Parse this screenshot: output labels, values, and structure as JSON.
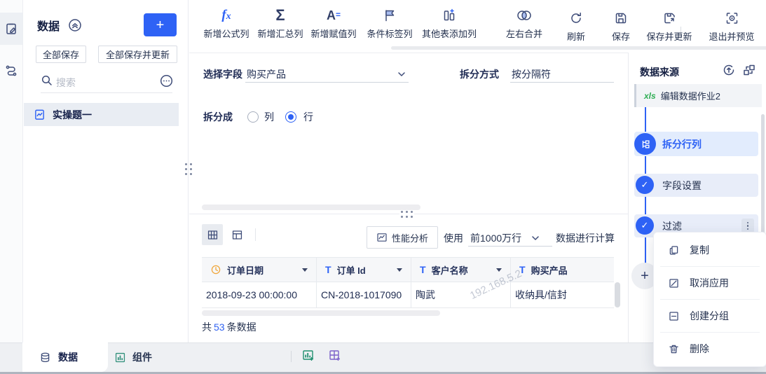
{
  "window": {
    "watermark": "192.168.5.2"
  },
  "colors": {
    "accent_blue": "#2e62f5",
    "text_navy": "#1e2b50",
    "xls_green": "#2fae54",
    "clock_orange": "#f0a63a",
    "chart_green": "#1f8f6e",
    "board_purple": "#7b61c9",
    "step_active_bg": "#e2ecfd",
    "step_bg": "#e8edf9",
    "selected_item_bg": "#e9edf3"
  },
  "left_rail": {
    "icons": [
      {
        "name": "edit-board-icon"
      },
      {
        "name": "flow-icon"
      }
    ]
  },
  "sidebar": {
    "title": "数据",
    "add_button": "+",
    "save_all": "全部保存",
    "save_all_update": "全部保存并更新",
    "search": {
      "placeholder": "搜索"
    },
    "items": [
      {
        "label": "实操题一"
      }
    ]
  },
  "toolbar": {
    "items": [
      {
        "label": "新增公式列",
        "icon": "formula-icon"
      },
      {
        "label": "新增汇总列",
        "icon": "sigma-icon"
      },
      {
        "label": "新增赋值列",
        "icon": "assign-value-icon"
      },
      {
        "label": "条件标签列",
        "icon": "flag-icon"
      },
      {
        "label": "其他表添加列",
        "icon": "add-column-icon"
      },
      {
        "label": "左右合并",
        "icon": "merge-icon"
      },
      {
        "label": "刷新",
        "icon": "refresh-icon"
      },
      {
        "label": "保存",
        "icon": "save-icon"
      },
      {
        "label": "保存并更新",
        "icon": "save-update-icon"
      },
      {
        "label": "退出并预览",
        "icon": "preview-icon"
      }
    ]
  },
  "form": {
    "select_field": {
      "label": "选择字段",
      "value": "购买产品"
    },
    "split_method": {
      "label": "拆分方式",
      "value": "按分隔符"
    },
    "split_into": {
      "label": "拆分成",
      "options": [
        {
          "label": "列",
          "selected": false
        },
        {
          "label": "行",
          "selected": true
        }
      ]
    }
  },
  "preview": {
    "performance_button": "性能分析",
    "use_label": "使用",
    "row_limit": "前1000万行",
    "calc_label": "数据进行计算",
    "total": {
      "prefix": "共",
      "count": "53",
      "suffix": "条数据"
    }
  },
  "table": {
    "columns": [
      {
        "label": "订单日期",
        "type": "date"
      },
      {
        "label": "订单 Id",
        "type": "text"
      },
      {
        "label": "客户名称",
        "type": "text"
      },
      {
        "label": "购买产品",
        "type": "text"
      }
    ],
    "rows": [
      {
        "order_date": "2018-09-23 00:00:00",
        "order_id": "CN-2018-1017090",
        "customer": "陶武",
        "product": "收纳具/信封"
      }
    ]
  },
  "right_panel": {
    "title": "数据来源",
    "add_button": "+",
    "source": {
      "badge": "xls",
      "label": "编辑数据作业2"
    },
    "steps": [
      {
        "label": "拆分行列",
        "state": "active"
      },
      {
        "label": "字段设置",
        "state": "done"
      },
      {
        "label": "过滤",
        "state": "done"
      }
    ]
  },
  "context_menu": {
    "items": [
      {
        "label": "复制",
        "icon": "copy-icon"
      },
      {
        "label": "取消应用",
        "icon": "cancel-apply-icon"
      },
      {
        "label": "创建分组",
        "icon": "create-group-icon"
      },
      {
        "label": "删除",
        "icon": "delete-icon"
      }
    ]
  },
  "bottom_bar": {
    "tabs": [
      {
        "label": "数据"
      },
      {
        "label": "组件"
      }
    ],
    "icons": [
      {
        "name": "add-chart-icon"
      },
      {
        "name": "add-dashboard-icon"
      }
    ]
  }
}
